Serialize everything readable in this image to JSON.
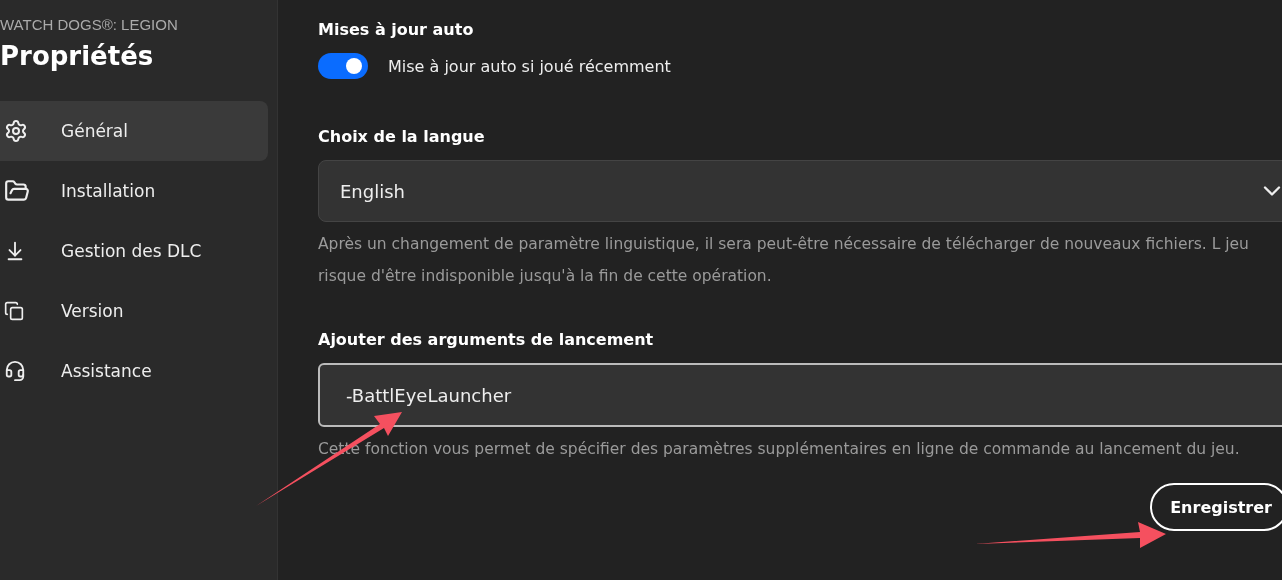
{
  "game_title": "WATCH DOGS®: LEGION",
  "page_title": "Propriétés",
  "sidebar": {
    "items": [
      {
        "label": "Général",
        "selected": true
      },
      {
        "label": "Installation",
        "selected": false
      },
      {
        "label": "Gestion des DLC",
        "selected": false
      },
      {
        "label": "Version",
        "selected": false
      },
      {
        "label": "Assistance",
        "selected": false
      }
    ]
  },
  "auto_update": {
    "heading": "Mises à jour auto",
    "toggle_label": "Mise à jour auto si joué récemment",
    "on": true
  },
  "language": {
    "heading": "Choix de la langue",
    "value": "English",
    "hint": "Après un changement de paramètre linguistique, il sera peut-être nécessaire de télécharger de nouveaux fichiers. L jeu risque d'être indisponible jusqu'à la fin de cette opération."
  },
  "launch_args": {
    "heading": "Ajouter des arguments de lancement",
    "value": "-BattlEyeLauncher",
    "hint": "Cette fonction vous permet de spécifier des paramètres supplémentaires en ligne de commande au lancement du jeu."
  },
  "save_button": "Enregistrer",
  "annotations": [
    {
      "kind": "arrow"
    },
    {
      "kind": "arrow"
    }
  ]
}
